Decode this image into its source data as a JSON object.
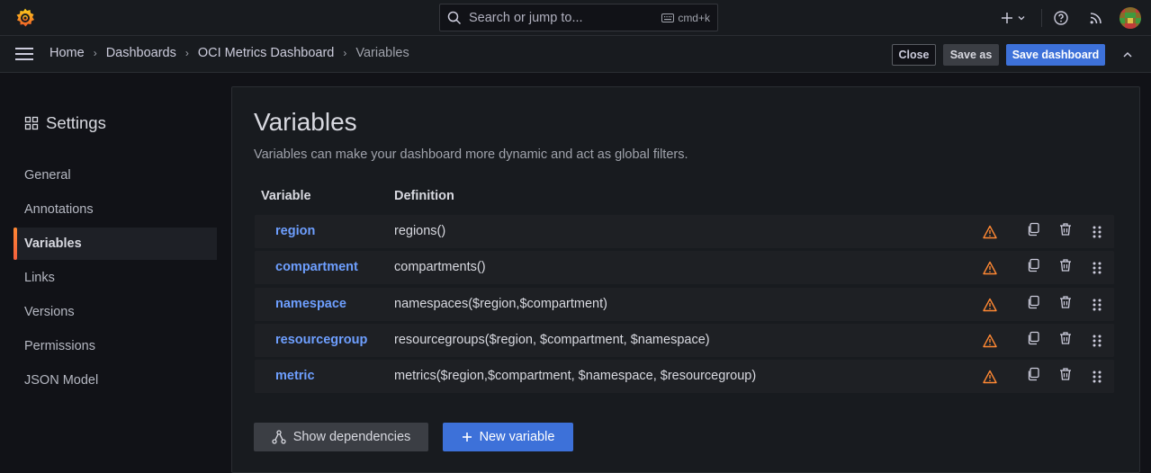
{
  "topbar": {
    "search_placeholder": "Search or jump to...",
    "search_shortcut": "cmd+k",
    "icons": [
      "grafana-logo-icon",
      "search-icon",
      "keyboard-icon",
      "plus-icon",
      "help-icon",
      "rss-icon",
      "avatar"
    ]
  },
  "breadcrumbs": [
    "Home",
    "Dashboards",
    "OCI Metrics Dashboard",
    "Variables"
  ],
  "actions": {
    "close": "Close",
    "save_as": "Save as",
    "save_dashboard": "Save dashboard"
  },
  "sidebar": {
    "title": "Settings",
    "items": [
      {
        "label": "General",
        "active": false
      },
      {
        "label": "Annotations",
        "active": false
      },
      {
        "label": "Variables",
        "active": true
      },
      {
        "label": "Links",
        "active": false
      },
      {
        "label": "Versions",
        "active": false
      },
      {
        "label": "Permissions",
        "active": false
      },
      {
        "label": "JSON Model",
        "active": false
      }
    ]
  },
  "main": {
    "title": "Variables",
    "subtitle": "Variables can make your dashboard more dynamic and act as global filters.",
    "columns": [
      "Variable",
      "Definition"
    ],
    "rows": [
      {
        "name": "region",
        "definition": "regions()"
      },
      {
        "name": "compartment",
        "definition": "compartments()"
      },
      {
        "name": "namespace",
        "definition": "namespaces($region,$compartment)"
      },
      {
        "name": "resourcegroup",
        "definition": "resourcegroups($region, $compartment, $namespace)"
      },
      {
        "name": "metric",
        "definition": "metrics($region,$compartment, $namespace, $resourcegroup)"
      }
    ],
    "show_dependencies": "Show dependencies",
    "new_variable": "New variable"
  },
  "colors": {
    "accent": "#3d71d9",
    "link": "#6e9fff",
    "warning": "#ff8833",
    "background": "#111217",
    "panel": "#181b1f"
  }
}
